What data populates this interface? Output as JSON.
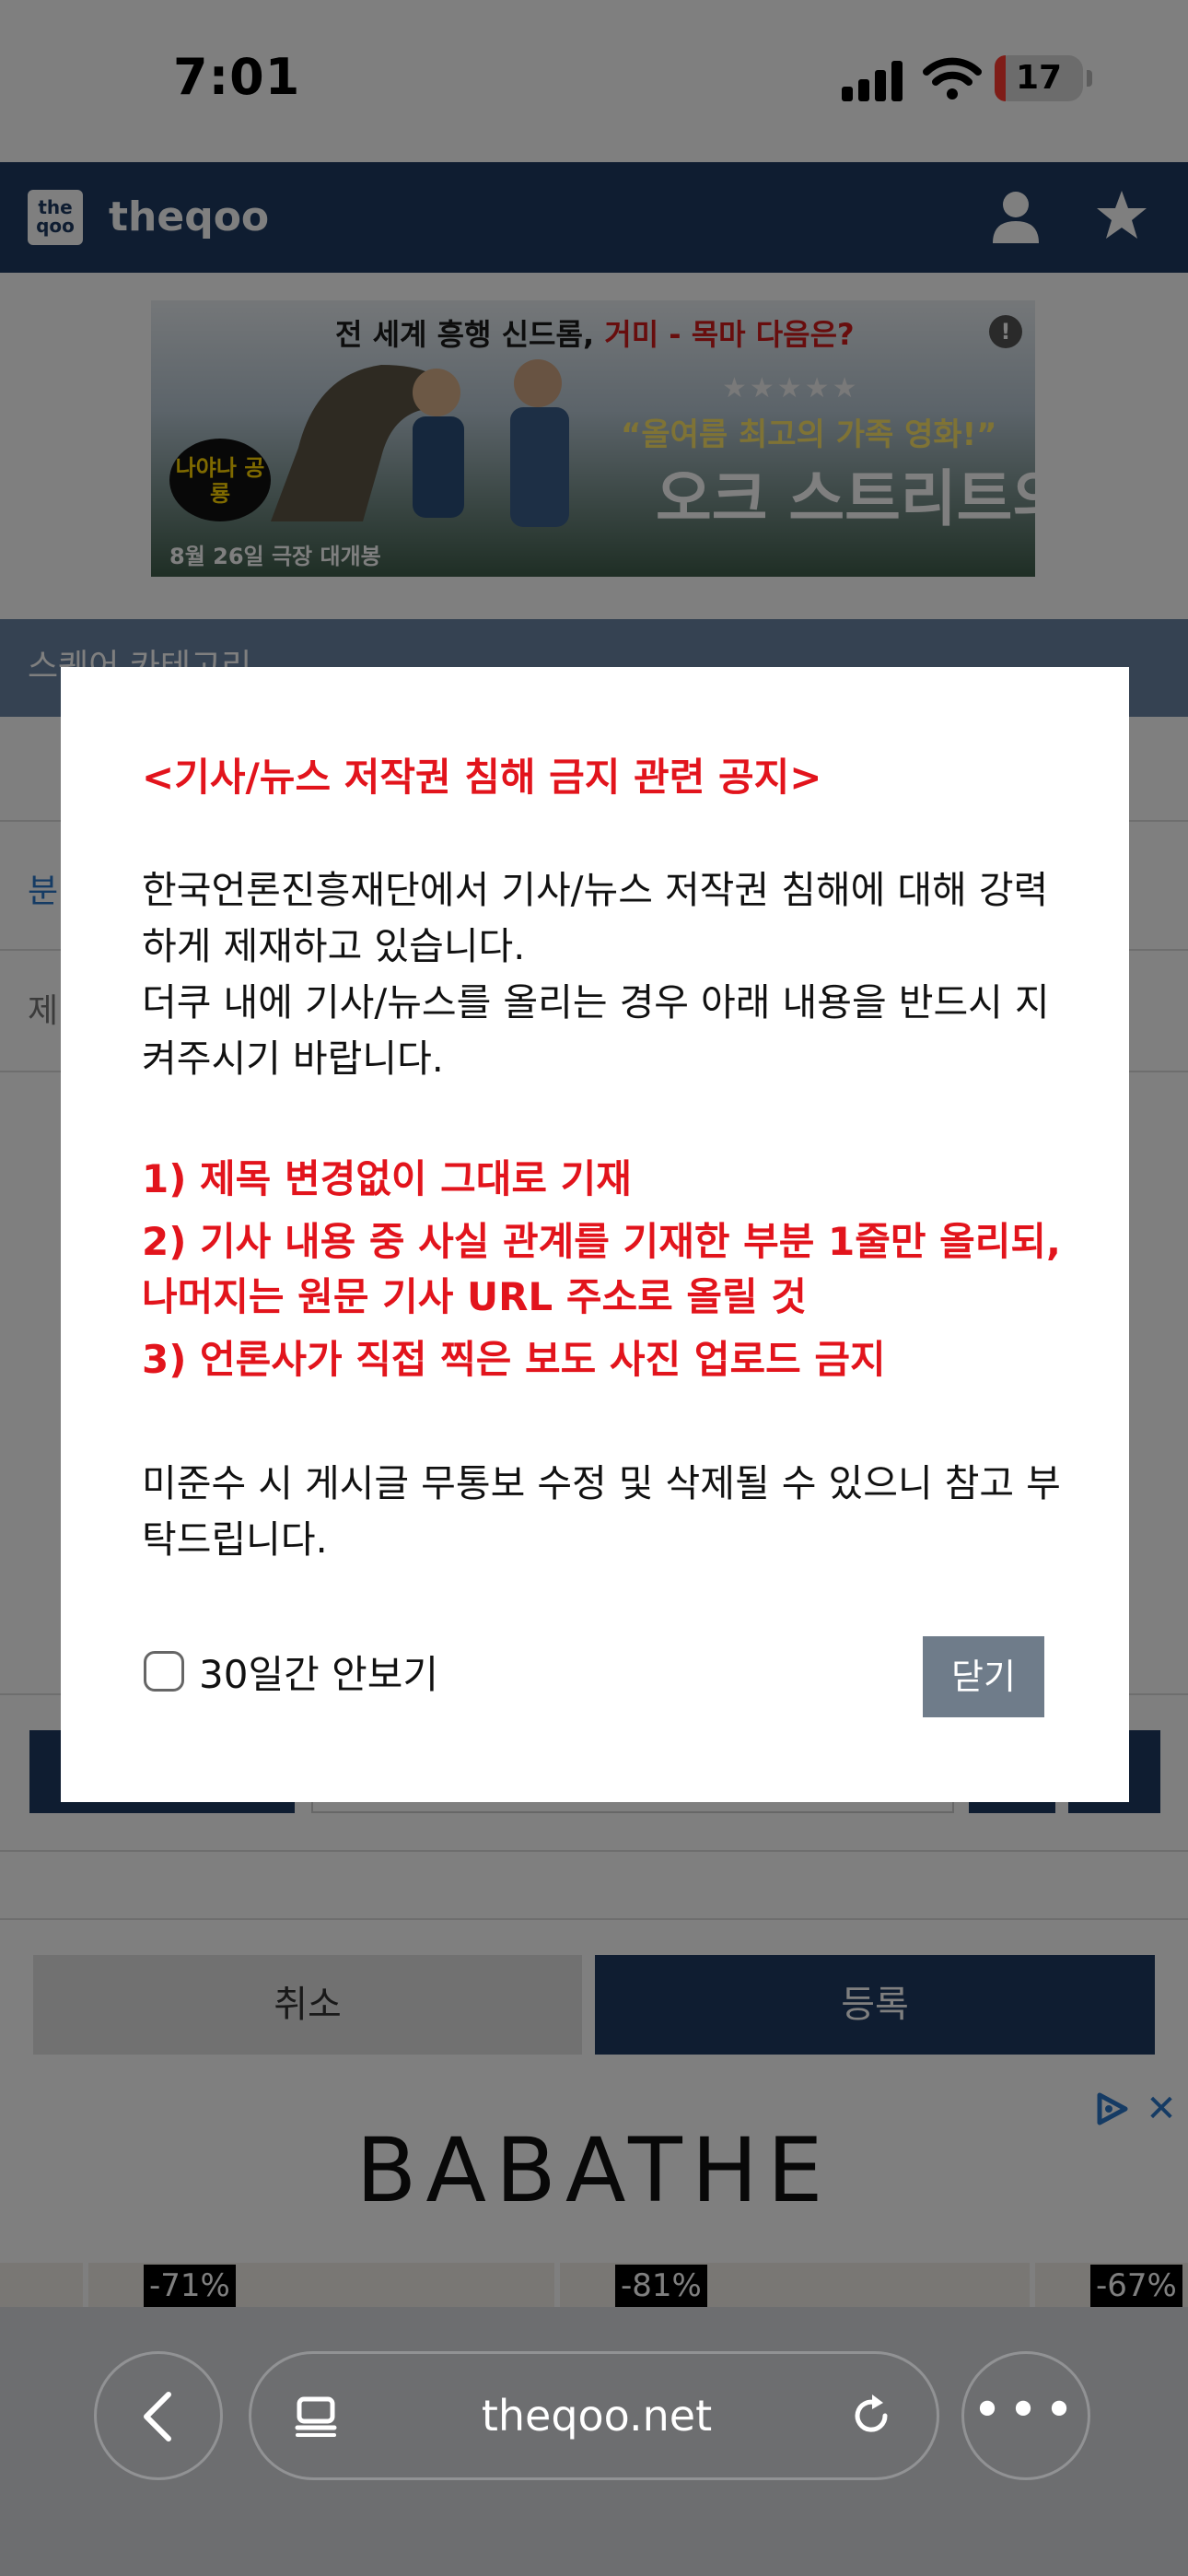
{
  "status_bar": {
    "time": "7:01",
    "battery": "17"
  },
  "header": {
    "logo_text": "the qoo",
    "site_name": "theqoo"
  },
  "top_ad": {
    "headline_prefix": "전 세계 흥행 신드롬, ",
    "headline_red": "거미 - 목마 다음은?",
    "stars": "★★★★★",
    "quote": "“올여름 최고의 가족 영화!”",
    "title": "오크 스트리트의 마지막 날",
    "badge": "나야나 공룡",
    "date": "8월 26일 극장 대개봉",
    "info": "!"
  },
  "page": {
    "category_label": "스퀘어 카테고리",
    "side_label_1": "분",
    "side_label_2": "제",
    "cancel_label": "취소",
    "submit_label": "등록"
  },
  "bottom_ad": {
    "brand": "BABATHE",
    "discounts": [
      "-71%",
      "-81%",
      "-67%"
    ]
  },
  "modal": {
    "title": "<기사/뉴스 저작권 침해 금지 관련 공지>",
    "body_lines": [
      "한국언론진흥재단에서 기사/뉴스 저작권 침해에 대해 강력하게 제재하고 있습니다.",
      "더쿠 내에 기사/뉴스를 올리는 경우 아래 내용을 반드시 지켜주시기 바랍니다."
    ],
    "rules": [
      "1) 제목 변경없이 그대로 기재",
      "2) 기사 내용 중 사실 관계를 기재한 부분 1줄만 올리되, 나머지는 원문 기사 URL 주소로 올릴 것",
      "3) 언론사가 직접 찍은 보도 사진 업로드 금지"
    ],
    "note": "미준수 시 게시글 무통보 수정 및 삭제될 수 있으니 참고 부탁드립니다.",
    "checkbox_label": "30일간 안보기",
    "close_label": "닫기"
  },
  "browser": {
    "url": "theqoo.net",
    "more": "•••"
  },
  "colors": {
    "header": "#1f3b63",
    "notice_red": "#e2141c",
    "close_button": "#6f7c8a"
  }
}
